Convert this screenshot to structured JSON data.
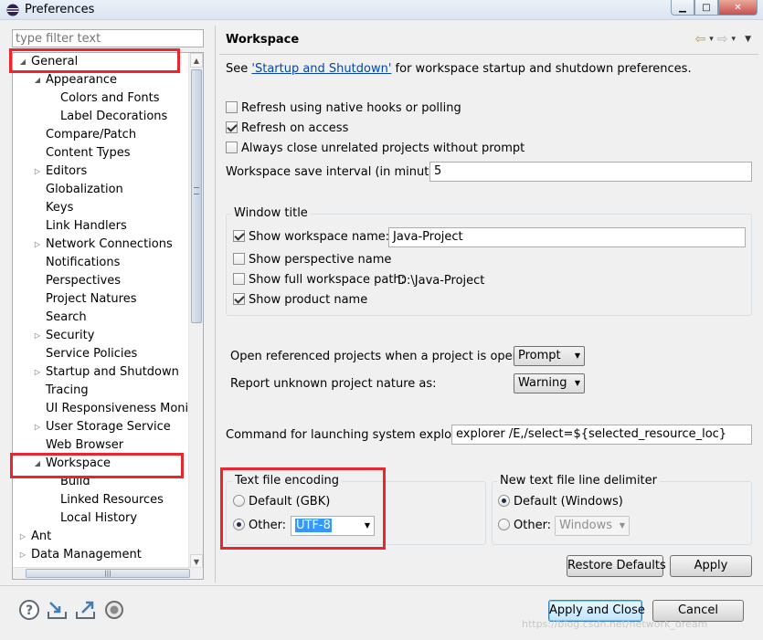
{
  "window": {
    "title": "Preferences",
    "buttons": [
      "minimize",
      "maximize",
      "close"
    ]
  },
  "filter": {
    "placeholder": "type filter text"
  },
  "tree": {
    "items": [
      {
        "label": "General",
        "depth": 0,
        "toggle": "expanded"
      },
      {
        "label": "Appearance",
        "depth": 1,
        "toggle": "expanded"
      },
      {
        "label": "Colors and Fonts",
        "depth": 2,
        "toggle": "none"
      },
      {
        "label": "Label Decorations",
        "depth": 2,
        "toggle": "none"
      },
      {
        "label": "Compare/Patch",
        "depth": 1,
        "toggle": "none"
      },
      {
        "label": "Content Types",
        "depth": 1,
        "toggle": "none"
      },
      {
        "label": "Editors",
        "depth": 1,
        "toggle": "collapsed"
      },
      {
        "label": "Globalization",
        "depth": 1,
        "toggle": "none"
      },
      {
        "label": "Keys",
        "depth": 1,
        "toggle": "none"
      },
      {
        "label": "Link Handlers",
        "depth": 1,
        "toggle": "none"
      },
      {
        "label": "Network Connections",
        "depth": 1,
        "toggle": "collapsed"
      },
      {
        "label": "Notifications",
        "depth": 1,
        "toggle": "none"
      },
      {
        "label": "Perspectives",
        "depth": 1,
        "toggle": "none"
      },
      {
        "label": "Project Natures",
        "depth": 1,
        "toggle": "none"
      },
      {
        "label": "Search",
        "depth": 1,
        "toggle": "none"
      },
      {
        "label": "Security",
        "depth": 1,
        "toggle": "collapsed"
      },
      {
        "label": "Service Policies",
        "depth": 1,
        "toggle": "none"
      },
      {
        "label": "Startup and Shutdown",
        "depth": 1,
        "toggle": "collapsed"
      },
      {
        "label": "Tracing",
        "depth": 1,
        "toggle": "none"
      },
      {
        "label": "UI Responsiveness Monito",
        "depth": 1,
        "toggle": "none"
      },
      {
        "label": "User Storage Service",
        "depth": 1,
        "toggle": "collapsed"
      },
      {
        "label": "Web Browser",
        "depth": 1,
        "toggle": "none"
      },
      {
        "label": "Workspace",
        "depth": 1,
        "toggle": "expanded",
        "selected": true
      },
      {
        "label": "Build",
        "depth": 2,
        "toggle": "none"
      },
      {
        "label": "Linked Resources",
        "depth": 2,
        "toggle": "none"
      },
      {
        "label": "Local History",
        "depth": 2,
        "toggle": "none"
      },
      {
        "label": "Ant",
        "depth": 0,
        "toggle": "collapsed"
      },
      {
        "label": "Data Management",
        "depth": 0,
        "toggle": "collapsed"
      }
    ]
  },
  "page": {
    "title": "Workspace",
    "see_prefix": "See ",
    "see_link": "'Startup and Shutdown'",
    "see_suffix": " for workspace startup and shutdown preferences.",
    "options": {
      "refresh_native": {
        "label": "Refresh using native hooks or polling",
        "checked": false
      },
      "refresh_access": {
        "label": "Refresh on access",
        "checked": true
      },
      "close_unrelated": {
        "label": "Always close unrelated projects without prompt",
        "checked": false
      }
    },
    "save_interval": {
      "label": "Workspace save interval (in minutes):",
      "value": "5"
    },
    "window_title": {
      "label": "Window title",
      "show_workspace_name": {
        "label": "Show workspace name:",
        "checked": true,
        "value": "Java-Project"
      },
      "show_perspective_name": {
        "label": "Show perspective name",
        "checked": false
      },
      "show_full_path": {
        "label": "Show full workspace path:",
        "checked": false,
        "value": "D:\\Java-Project"
      },
      "show_product_name": {
        "label": "Show product name",
        "checked": true
      }
    },
    "open_referenced": {
      "label": "Open referenced projects when a project is opened:",
      "value": "Prompt"
    },
    "unknown_nature": {
      "label": "Report unknown project nature as:",
      "value": "Warning"
    },
    "explorer_cmd": {
      "label": "Command for launching system explorer:",
      "value": "explorer /E,/select=${selected_resource_loc}"
    },
    "encoding": {
      "label": "Text file encoding",
      "default_label": "Default (GBK)",
      "other_label": "Other:",
      "other_value": "UTF-8",
      "selected": "other"
    },
    "delimiter": {
      "label": "New text file line delimiter",
      "default_label": "Default (Windows)",
      "other_label": "Other:",
      "other_value": "Windows",
      "selected": "default"
    },
    "restore_defaults": "Restore Defaults",
    "apply": "Apply"
  },
  "footer": {
    "apply_close": "Apply and Close",
    "cancel": "Cancel",
    "icons": [
      "help-icon",
      "import-icon",
      "export-icon",
      "record-icon"
    ]
  },
  "watermark": "https://blog.csdn.net/network_dream",
  "colors": {
    "highlight": "#e8262d",
    "link": "#0645ad",
    "selection": "#3399ff"
  }
}
